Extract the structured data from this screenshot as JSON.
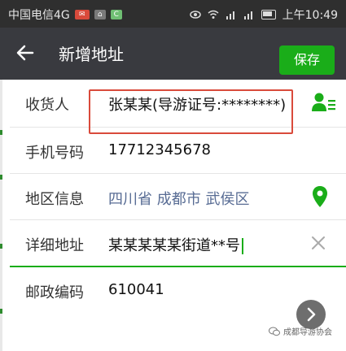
{
  "status_bar": {
    "carrier": "中国电信4G",
    "time": "上午10:49"
  },
  "nav": {
    "title": "新增地址",
    "save_label": "保存"
  },
  "form": {
    "rows": [
      {
        "label": "收货人",
        "value": "张某某(导游证号:********)"
      },
      {
        "label": "手机号码",
        "value": "17712345678"
      },
      {
        "label": "地区信息",
        "value": "四川省 成都市 武侯区"
      },
      {
        "label": "详细地址",
        "value": "某某某某某街道**号"
      },
      {
        "label": "邮政编码",
        "value": "610041"
      }
    ]
  },
  "watermark": {
    "text": "成都导游协会"
  },
  "colors": {
    "nav_bg": "#393a3f",
    "accent": "#1aad19",
    "highlight": "#d94a3b",
    "region_text": "#586c94"
  },
  "icons": [
    "back-arrow-icon",
    "contact-list-icon",
    "location-pin-icon",
    "clear-icon",
    "chevron-right-icon",
    "wechat-icon"
  ]
}
